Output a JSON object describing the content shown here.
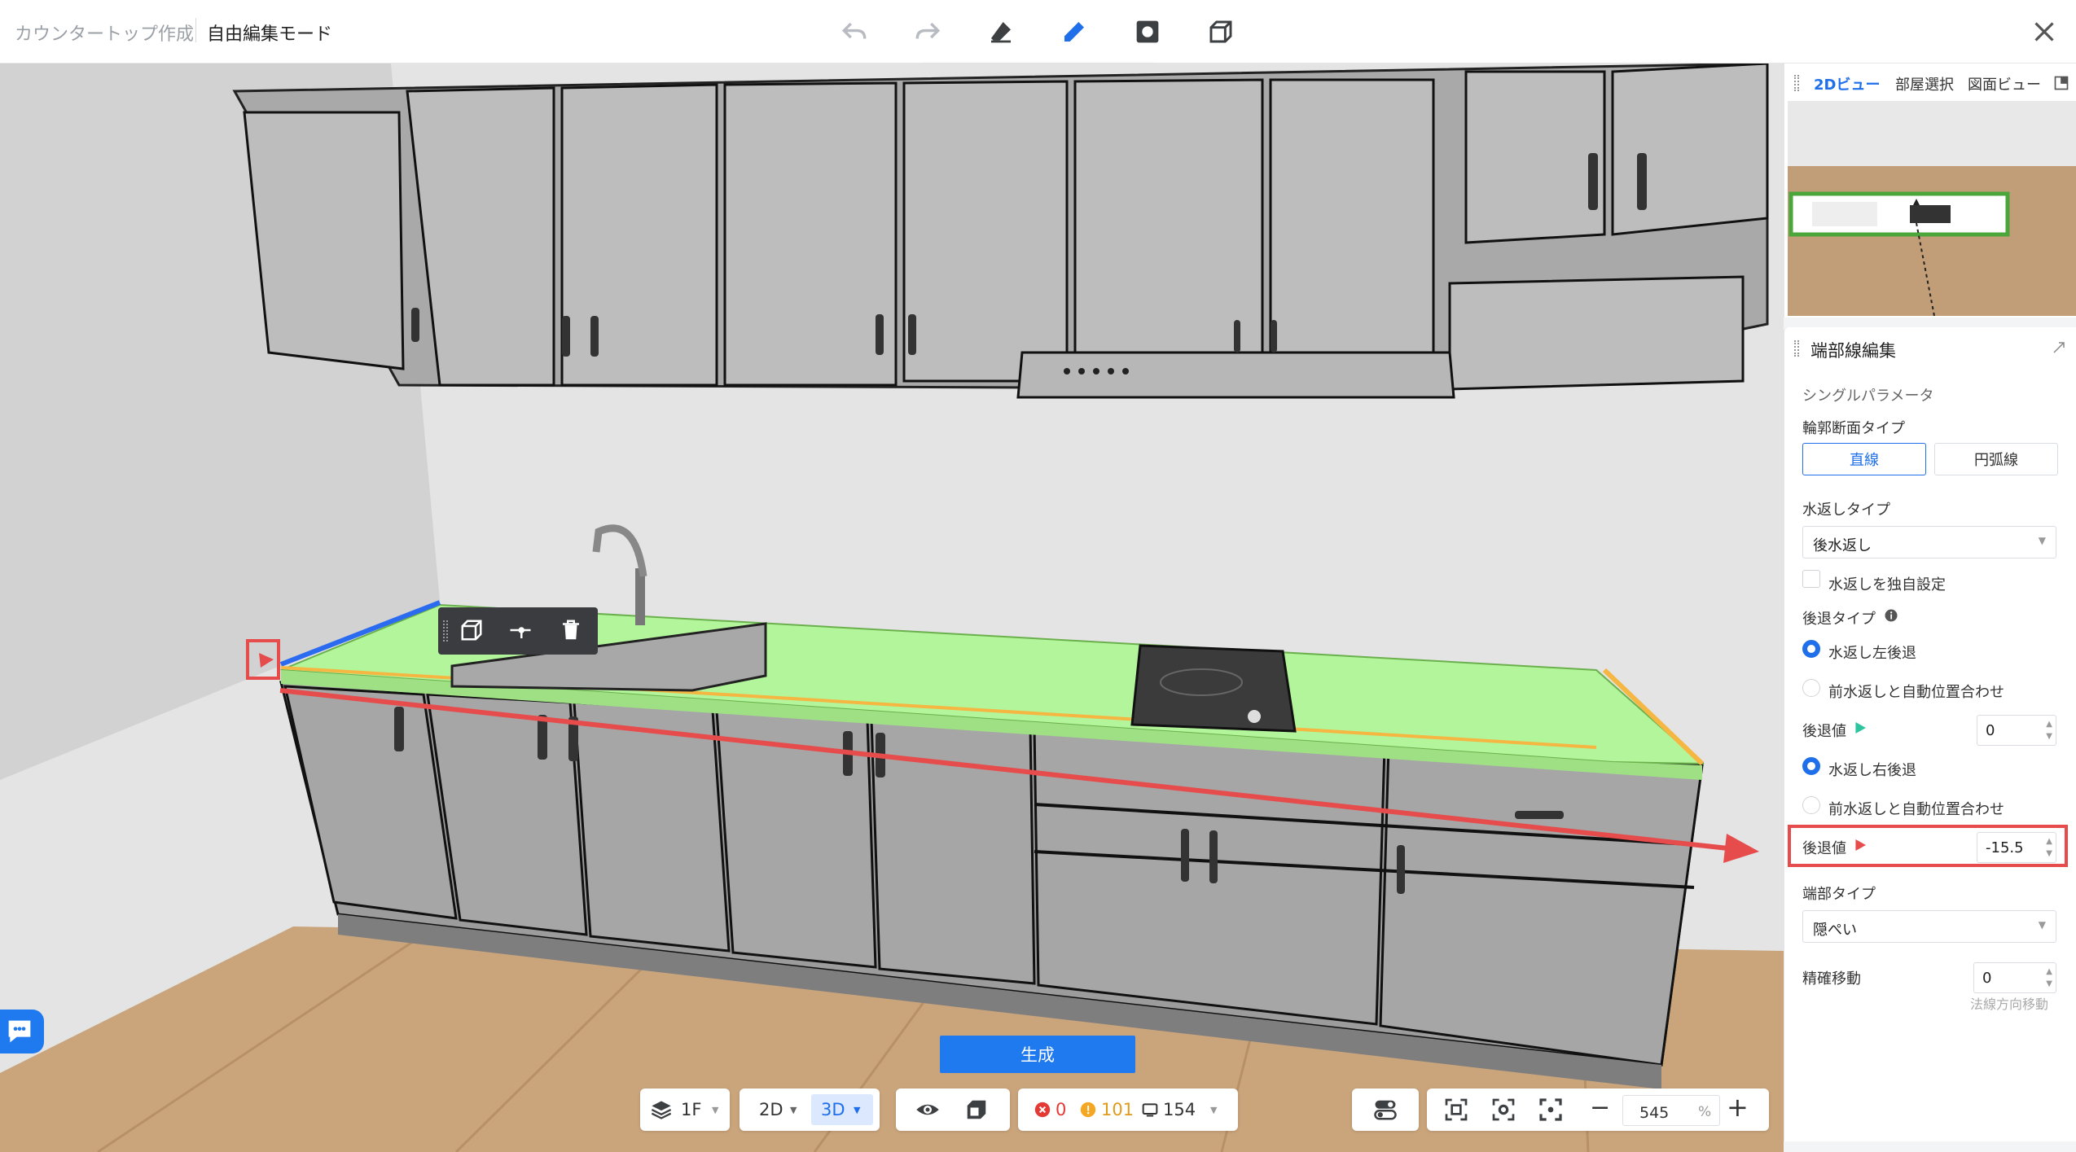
{
  "header": {
    "breadcrumb_parent": "カウンタートップ作成",
    "breadcrumb_current": "自由編集モード"
  },
  "minimap": {
    "tabs": [
      "2Dビュー",
      "部屋選択",
      "図面ビュー"
    ]
  },
  "panel": {
    "title": "端部線編集",
    "section": "シングルパラメータ",
    "profile_label": "輪郭断面タイプ",
    "profile_options": [
      "直線",
      "円弧線"
    ],
    "backsplash_label": "水返しタイプ",
    "backsplash_value": "後水返し",
    "custom_backsplash_label": "水返しを独自設定",
    "setback_type_label": "後退タイプ",
    "radio_left_setback": "水返し左後退",
    "radio_front_align_1": "前水返しと自動位置合わせ",
    "setback_value_label_1": "後退値",
    "setback_value_1": "0",
    "radio_right_setback": "水返し右後退",
    "radio_front_align_2": "前水返しと自動位置合わせ",
    "setback_value_label_2": "後退値",
    "setback_value_2": "-15.5",
    "end_type_label": "端部タイプ",
    "end_type_value": "隠ぺい",
    "precise_move_label": "精確移動",
    "precise_move_value": "0",
    "normal_direction_label": "法線方向移動"
  },
  "bottom": {
    "generate_label": "生成",
    "floor_label": "1F",
    "view_2d": "2D",
    "view_3d": "3D",
    "error_count": "0",
    "warning_count": "101",
    "object_count": "154",
    "zoom_value": "545",
    "zoom_unit": "%"
  },
  "colors": {
    "accent": "#1f7af0",
    "highlight": "#e74c4c",
    "countertop": "#b3f59a",
    "edge_blue": "#2a6bf0",
    "edge_orange": "#f5b642"
  }
}
